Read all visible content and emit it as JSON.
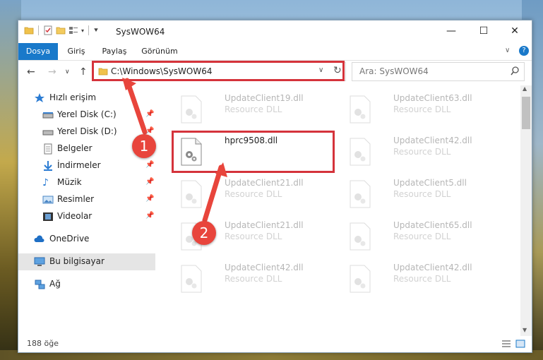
{
  "window": {
    "title": "SysWOW64"
  },
  "ribbon": {
    "tabs": [
      "Dosya",
      "Giriş",
      "Paylaş",
      "Görünüm"
    ]
  },
  "navigation": {
    "address": "C:\\Windows\\SysWOW64",
    "search_placeholder": "Ara: SysWOW64"
  },
  "sidebar": {
    "items": [
      {
        "label": "Hızlı erişim",
        "icon": "star-icon"
      },
      {
        "label": "Yerel Disk (C:)",
        "icon": "drive-icon",
        "pinned": true
      },
      {
        "label": "Yerel Disk (D:)",
        "icon": "drive-icon",
        "pinned": true
      },
      {
        "label": "Belgeler",
        "icon": "document-icon",
        "pinned": true
      },
      {
        "label": "İndirmeler",
        "icon": "download-icon",
        "pinned": true
      },
      {
        "label": "Müzik",
        "icon": "music-icon",
        "pinned": true
      },
      {
        "label": "Resimler",
        "icon": "picture-icon",
        "pinned": true
      },
      {
        "label": "Videolar",
        "icon": "video-icon",
        "pinned": true
      },
      {
        "label": "OneDrive",
        "icon": "cloud-icon"
      },
      {
        "label": "Bu bilgisayar",
        "icon": "computer-icon",
        "selected": true
      },
      {
        "label": "Ağ",
        "icon": "network-icon"
      }
    ]
  },
  "files": [
    {
      "name": "UpdateClient19.dll",
      "type": "Resource DLL"
    },
    {
      "name": "UpdateClient63.dll",
      "type": "Resource DLL"
    },
    {
      "name": "hprc9508.dll",
      "type": ""
    },
    {
      "name": "UpdateClient42.dll",
      "type": "Resource DLL"
    },
    {
      "name": "UpdateClient21.dll",
      "type": "Resource DLL"
    },
    {
      "name": "UpdateClient5.dll",
      "type": "Resource DLL"
    },
    {
      "name": "UpdateClient21.dll",
      "type": "Resource DLL"
    },
    {
      "name": "UpdateClient65.dll",
      "type": "Resource DLL"
    },
    {
      "name": "UpdateClient42.dll",
      "type": "Resource DLL"
    },
    {
      "name": "UpdateClient42.dll",
      "type": "Resource DLL"
    }
  ],
  "status": {
    "count": "188 öğe"
  },
  "annotations": {
    "step1": "1",
    "step2": "2"
  },
  "colors": {
    "accent": "#1979ca",
    "highlight": "#d5333b",
    "arrow": "#e8453c"
  }
}
